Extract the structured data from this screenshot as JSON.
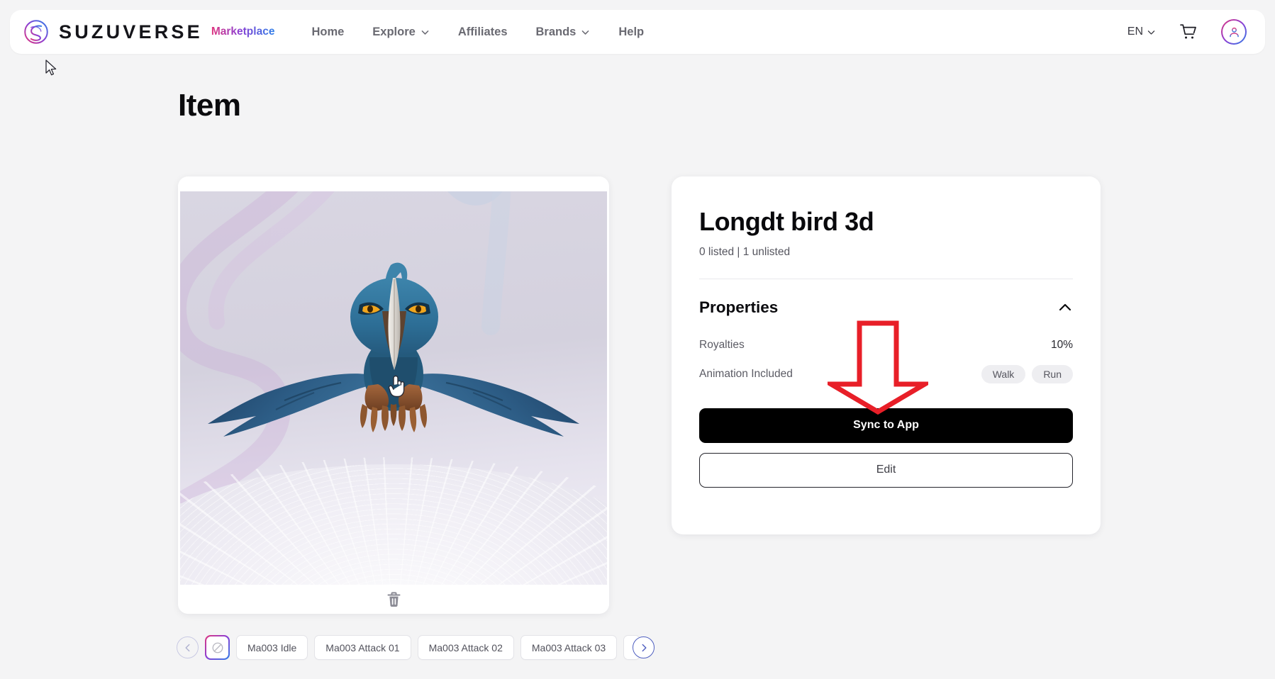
{
  "navbar": {
    "brand_name": "SUZUVERSE",
    "brand_sub": "Marketplace",
    "logo_icon": "suzuverse-globe-logo",
    "links": [
      {
        "label": "Home",
        "has_chevron": false
      },
      {
        "label": "Explore",
        "has_chevron": true
      },
      {
        "label": "Affiliates",
        "has_chevron": false
      },
      {
        "label": "Brands",
        "has_chevron": true
      },
      {
        "label": "Help",
        "has_chevron": false
      }
    ],
    "language": "EN",
    "cart_icon": "shopping-cart-icon",
    "avatar_icon": "user-avatar-icon",
    "chevron_icon": "chevron-down-icon"
  },
  "page": {
    "title": "Item"
  },
  "viewer": {
    "model_name": "blue-bird-3d-model",
    "delete_icon": "trash-icon"
  },
  "animations": {
    "prev_label": "‹",
    "next_label": "›",
    "none_icon": "no-animation-icon",
    "chips": [
      "Ma003 Idle",
      "Ma003 Attack 01",
      "Ma003 Attack 02",
      "Ma003 Attack 03"
    ]
  },
  "detail": {
    "title": "Longdt bird 3d",
    "listed_text": "0 listed | 1 unlisted",
    "properties_label": "Properties",
    "collapse_icon": "chevron-up-icon",
    "rows": [
      {
        "key": "Royalties",
        "value": "10%",
        "badges": []
      },
      {
        "key": "Animation Included",
        "value": "",
        "badges": [
          "Walk",
          "Run"
        ]
      }
    ],
    "primary_button": "Sync to App",
    "secondary_button": "Edit"
  },
  "annotation": {
    "arrow_icon": "red-down-arrow-annotation",
    "color": "#e81f28"
  },
  "colors": {
    "page_bg": "#f4f4f5",
    "card_bg": "#ffffff",
    "text_primary": "#0a0a0e",
    "text_muted": "#5b5b64",
    "accent_pink": "#e0377f",
    "accent_purple": "#8b3fd4",
    "accent_blue": "#2f7fe8",
    "button_black": "#000000",
    "annotation_red": "#e81f28"
  }
}
